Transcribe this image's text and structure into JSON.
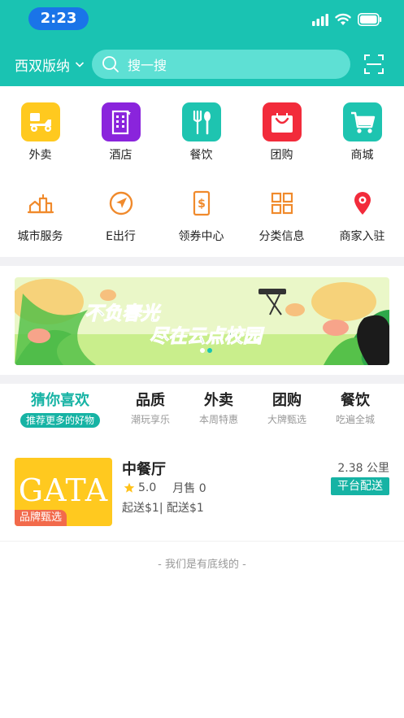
{
  "status_bar": {
    "time": "2:23"
  },
  "header": {
    "city": "西双版纳",
    "search_placeholder": "搜一搜"
  },
  "categories_row1": [
    {
      "label": "外卖",
      "icon": "scooter-icon",
      "color": "#ffc91f"
    },
    {
      "label": "酒店",
      "icon": "hotel-icon",
      "color": "#8a24dc"
    },
    {
      "label": "餐饮",
      "icon": "fork-knife-icon",
      "color": "#1ec4b0"
    },
    {
      "label": "团购",
      "icon": "shopping-bag-icon",
      "color": "#f22b3b"
    },
    {
      "label": "商城",
      "icon": "cart-icon",
      "color": "#1ec4b0"
    }
  ],
  "categories_row2": [
    {
      "label": "城市服务",
      "icon": "city-icon",
      "color": "#f08a2c"
    },
    {
      "label": "E出行",
      "icon": "compass-icon",
      "color": "#f08a2c"
    },
    {
      "label": "领券中心",
      "icon": "coupon-icon",
      "color": "#f08a2c"
    },
    {
      "label": "分类信息",
      "icon": "grid-icon",
      "color": "#f08a2c"
    },
    {
      "label": "商家入驻",
      "icon": "location-pin-icon",
      "color": "#f22b3b"
    }
  ],
  "banner": {
    "line1": "不负春光",
    "line2": "尽在云点校园"
  },
  "tabs": [
    {
      "title": "猜你喜欢",
      "sub": "推荐更多的好物",
      "active": true
    },
    {
      "title": "品质",
      "sub": "潮玩享乐"
    },
    {
      "title": "外卖",
      "sub": "本周特惠"
    },
    {
      "title": "团购",
      "sub": "大牌甄选"
    },
    {
      "title": "餐饮",
      "sub": "吃遍全城"
    }
  ],
  "shop": {
    "logo_text": "GATA",
    "tag": "品牌甄选",
    "name": "中餐厅",
    "rating": "5.0",
    "monthly_sales": "月售 0",
    "fees": "起送$1| 配送$1",
    "distance": "2.38 公里",
    "delivery": "平台配送"
  },
  "footer_text": "- 我们是有底线的 -",
  "colors": {
    "primary": "#1ac3b2",
    "accent": "#16b3a4",
    "orange": "#f08a2c"
  }
}
